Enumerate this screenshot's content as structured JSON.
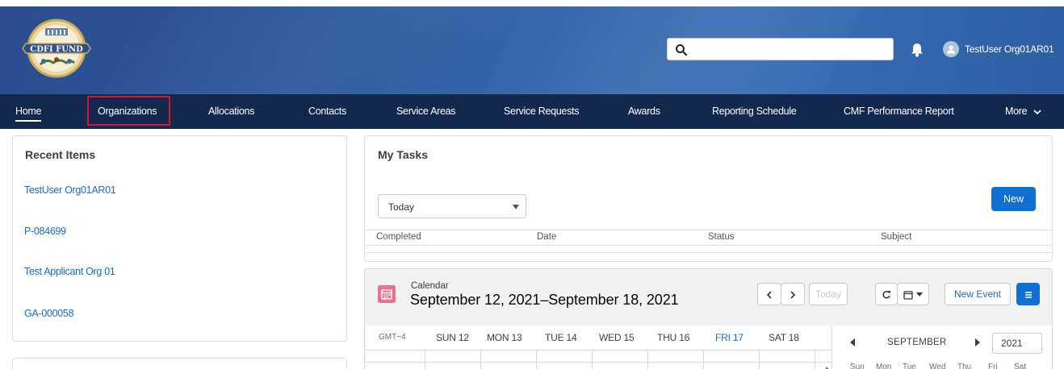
{
  "header": {
    "logo_text": "CDFI FUND",
    "search": {
      "value": "",
      "placeholder": ""
    },
    "user_name": "TestUser Org01AR01"
  },
  "nav": {
    "items": [
      {
        "label": "Home"
      },
      {
        "label": "Organizations"
      },
      {
        "label": "Allocations"
      },
      {
        "label": "Contacts"
      },
      {
        "label": "Service Areas"
      },
      {
        "label": "Service Requests"
      },
      {
        "label": "Awards"
      },
      {
        "label": "Reporting Schedule"
      },
      {
        "label": "CMF Performance Report"
      },
      {
        "label": "More"
      }
    ]
  },
  "recent_items": {
    "title": "Recent Items",
    "items": [
      "TestUser Org01AR01",
      "P-084699",
      "Test Applicant Org 01",
      "GA-000058"
    ]
  },
  "tasks": {
    "title": "My Tasks",
    "filter": "Today",
    "new_label": "New",
    "columns": [
      "Completed",
      "Date",
      "Status",
      "Subject"
    ]
  },
  "calendar": {
    "label": "Calendar",
    "range": "September 12, 2021–September 18, 2021",
    "today_label": "Today",
    "new_event_label": "New Event",
    "timezone": "GMT−4",
    "days": [
      "SUN 12",
      "MON 13",
      "TUE 14",
      "WED 15",
      "THU 16",
      "FRI 17",
      "SAT 18"
    ],
    "mini": {
      "month": "SEPTEMBER",
      "year": "2021",
      "dow": [
        "Sun",
        "Mon",
        "Tue",
        "Wed",
        "Thu",
        "Fri",
        "Sat"
      ]
    }
  },
  "colors": {
    "nav_bg": "#14284f",
    "header_bg": "#2b5a9e",
    "link": "#1a6bc4",
    "primary_button": "#0e70d2",
    "highlight": "#d6152d",
    "calendar_icon": "#eb7092"
  }
}
